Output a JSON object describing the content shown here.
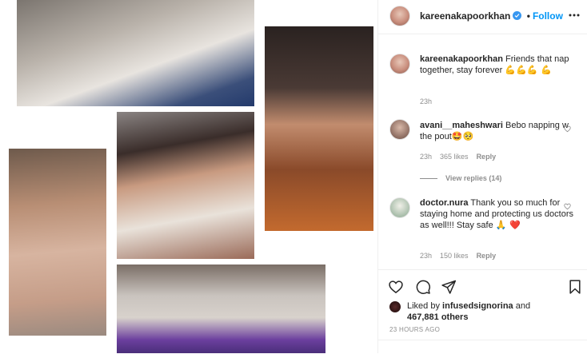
{
  "post": {
    "username": "kareenakapoorkhan",
    "follow_label": "Follow",
    "dot": "•"
  },
  "caption": {
    "username": "kareenakapoorkhan",
    "text": "Friends that nap together, stay forever",
    "emoji": "💪💪💪 💪",
    "time": "23h"
  },
  "comments": [
    {
      "username": "avani__maheshwari",
      "text": "Bebo napping w the pout",
      "emoji": "🤩🥺",
      "time": "23h",
      "likes": "365 likes",
      "reply": "Reply"
    },
    {
      "username": "doctor.nura",
      "text": "Thank you so much for staying home and protecting us doctors as well!!! Stay safe",
      "emoji": "🙏 ❤️",
      "time": "23h",
      "likes": "150 likes",
      "reply": "Reply"
    }
  ],
  "view_replies": "View replies (14)",
  "liked_by": {
    "prefix": "Liked by",
    "user": "infusedsignorina",
    "middle": "and",
    "count": "467,881 others"
  },
  "timestamp": "23 HOURS AGO",
  "icons": [
    "heart-icon",
    "comment-icon",
    "share-icon",
    "save-icon",
    "more-icon",
    "verified-icon"
  ],
  "colors": {
    "accent": "#0095f6",
    "text": "#262626",
    "muted": "#8e8e8e",
    "border": "#efefef"
  }
}
